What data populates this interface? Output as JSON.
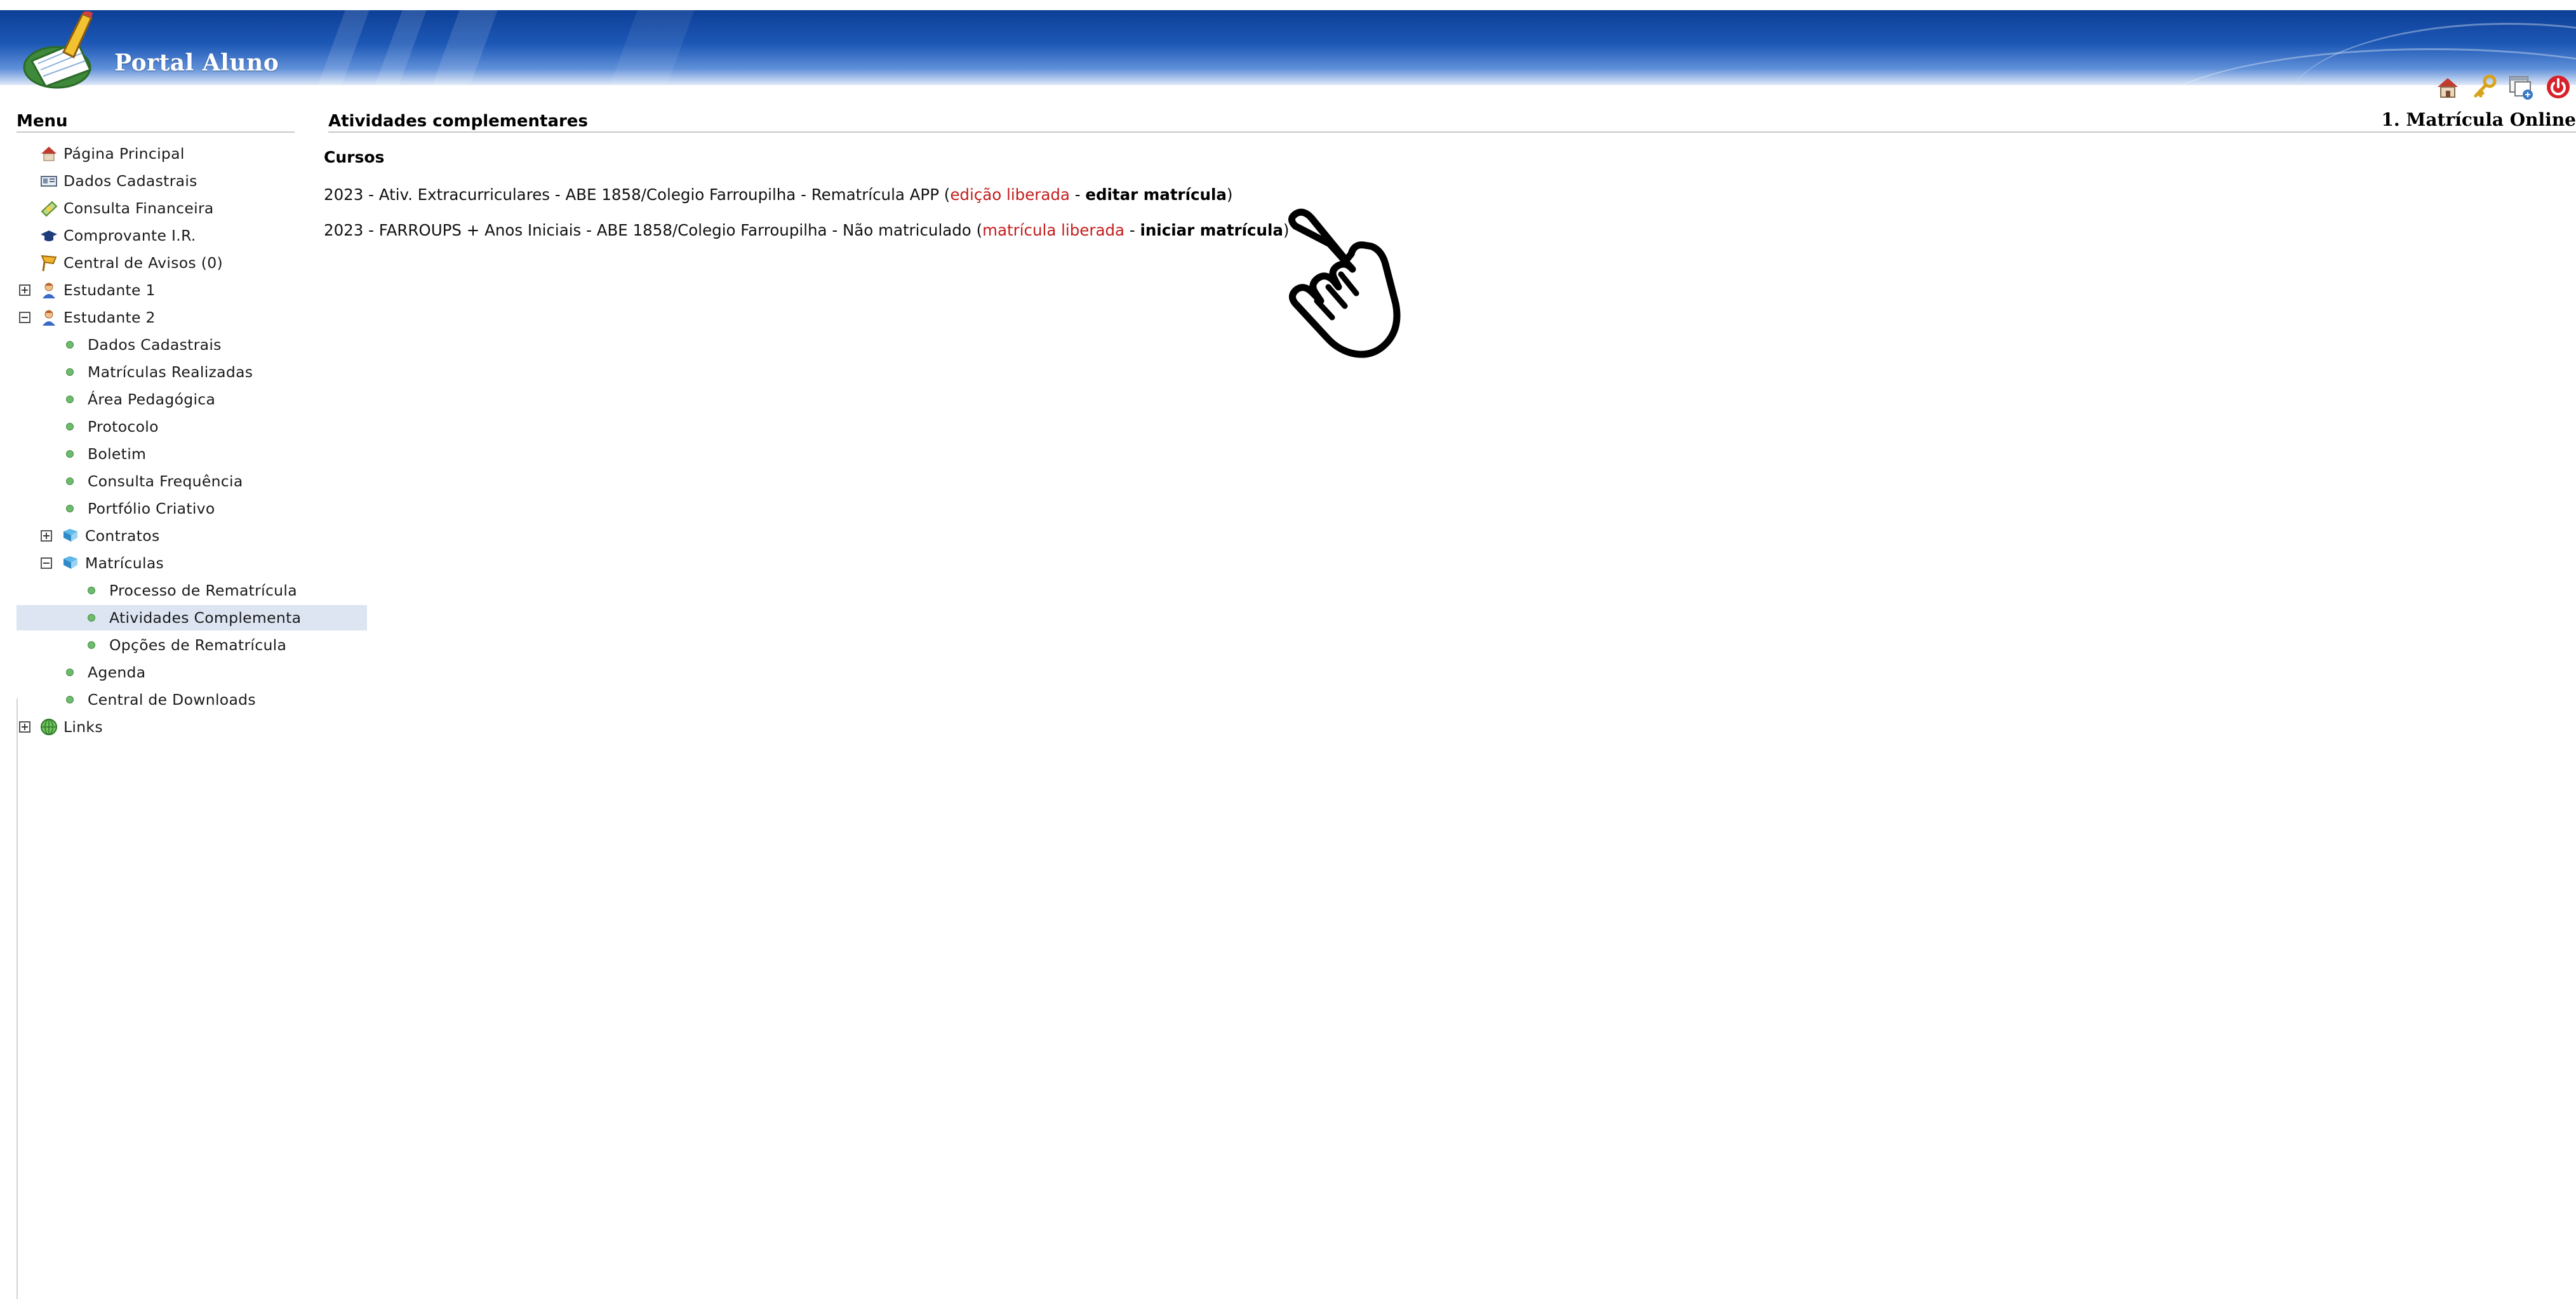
{
  "header": {
    "portal_title": "Portal Aluno",
    "icons": [
      "home-icon",
      "key-icon",
      "window-settings-icon",
      "power-icon"
    ]
  },
  "sidebar": {
    "heading": "Menu",
    "items": [
      {
        "label": "Página Principal",
        "icon": "house-icon",
        "level": 0
      },
      {
        "label": "Dados Cadastrais",
        "icon": "id-card-icon",
        "level": 0
      },
      {
        "label": "Consulta Financeira",
        "icon": "money-icon",
        "level": 0
      },
      {
        "label": "Comprovante I.R.",
        "icon": "graduation-cap-icon",
        "level": 0
      },
      {
        "label": "Central de Avisos (0)",
        "icon": "flag-icon",
        "level": 0
      },
      {
        "label": "Estudante 1",
        "icon": "student-icon",
        "expander": "+"
      },
      {
        "label": "Estudante 2",
        "icon": "student-icon",
        "expander": "-"
      },
      {
        "label": "Dados Cadastrais"
      },
      {
        "label": "Matrículas Realizadas"
      },
      {
        "label": "Área Pedagógica"
      },
      {
        "label": "Protocolo"
      },
      {
        "label": "Boletim"
      },
      {
        "label": "Consulta Frequência"
      },
      {
        "label": "Portfólio Criativo"
      },
      {
        "label": "Contratos",
        "expander": "+",
        "icon": "book-icon"
      },
      {
        "label": "Matrículas",
        "expander": "-",
        "icon": "book-icon"
      },
      {
        "label": "Processo de Rematrícula"
      },
      {
        "label": "Atividades Complementa",
        "selected": true
      },
      {
        "label": "Opções de Rematrícula"
      },
      {
        "label": "Agenda"
      },
      {
        "label": "Central de Downloads"
      },
      {
        "label": "Links",
        "expander": "+",
        "icon": "globe-icon"
      }
    ]
  },
  "main": {
    "page_title": "Atividades complementares",
    "right_title": "1. Matrícula Online",
    "cursos_heading": "Cursos",
    "courses": [
      {
        "text": "2023 - Ativ. Extracurriculares - ABE 1858/Colegio Farroupilha - Rematrícula APP (",
        "status": "edição liberada",
        "separator": " - ",
        "action": "editar matrícula",
        "close": ")"
      },
      {
        "text": "2023 - FARROUPS + Anos Iniciais - ABE 1858/Colegio Farroupilha - Não matriculado (",
        "status": "matrícula liberada",
        "separator": " - ",
        "action": "iniciar matrícula",
        "close": ")"
      }
    ]
  },
  "colors": {
    "header_blue": "#1d58b6",
    "status_red": "#c41d1d",
    "selected_bg": "#dde5f3",
    "bullet_green": "#6fba6f"
  }
}
